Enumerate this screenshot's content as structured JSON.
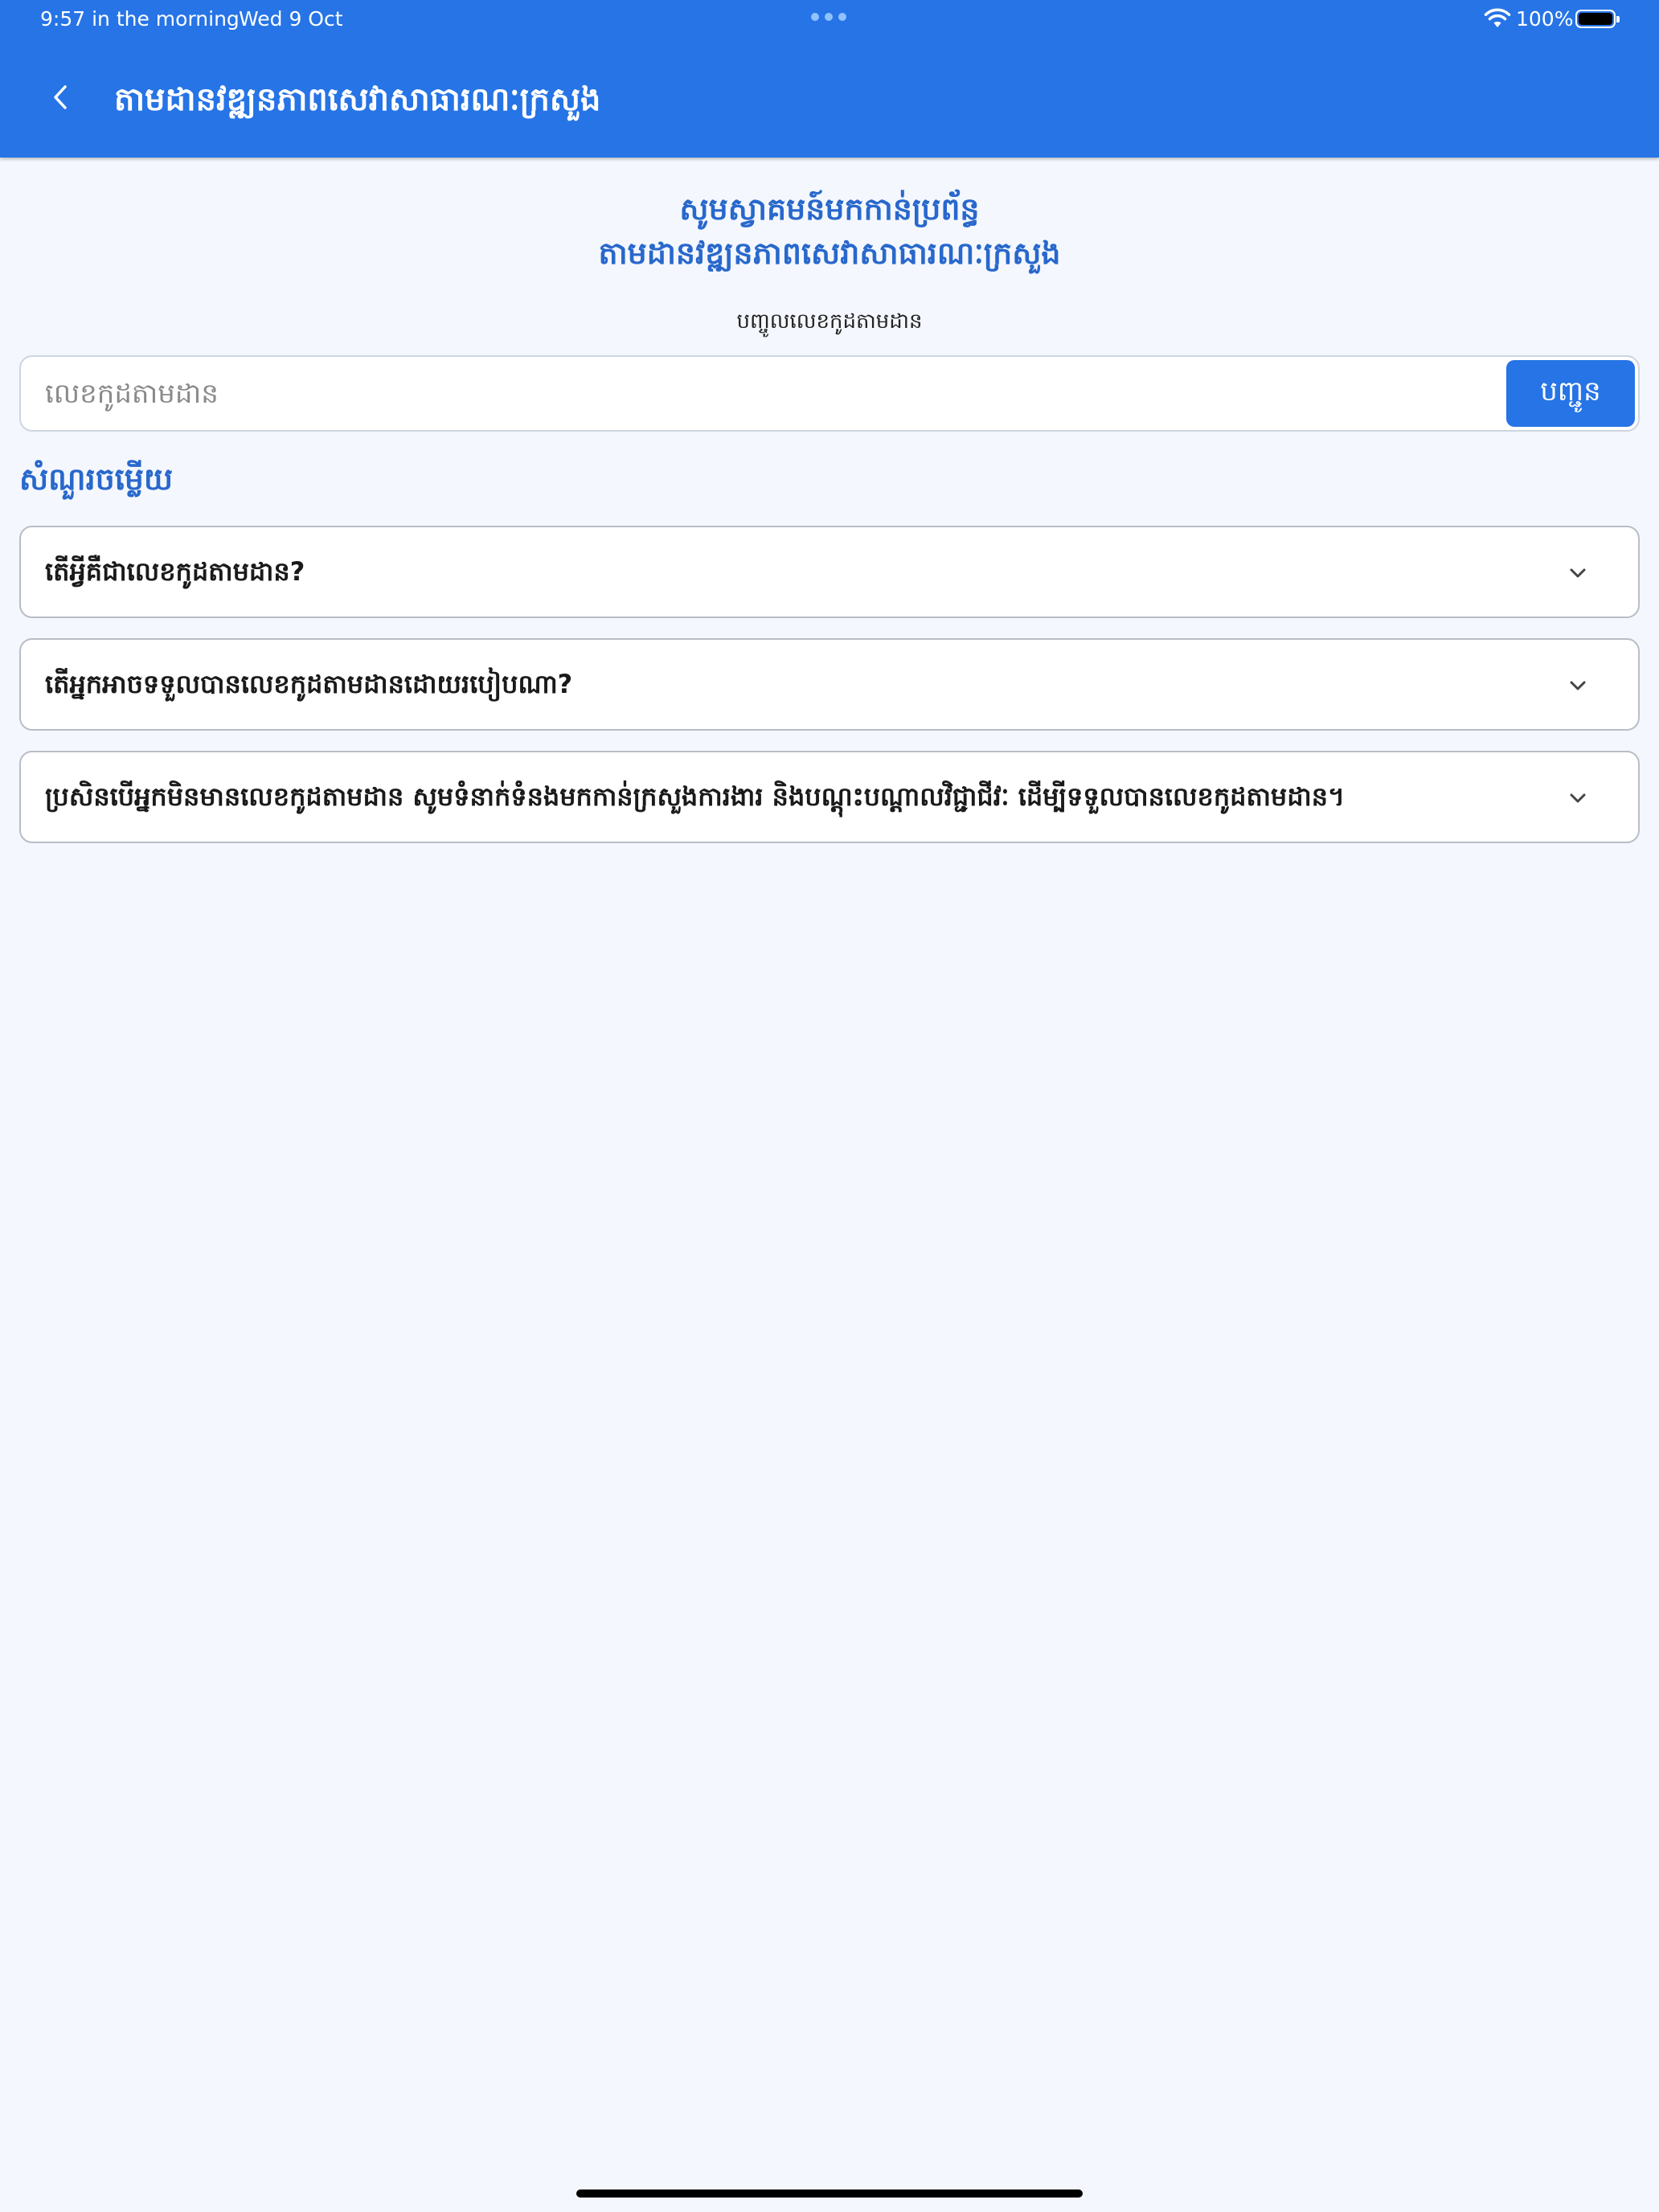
{
  "status_bar": {
    "time": "9:57 in the morning",
    "date": "Wed 9 Oct",
    "battery_percent": "100%",
    "wifi_icon": "wifi-icon",
    "battery_icon": "battery-icon"
  },
  "nav": {
    "back_icon": "chevron-left-icon",
    "title": "តាមដានវឌ្ឍនភាពសេវាសាធារណៈក្រសួង"
  },
  "welcome": {
    "line1": "សូមស្វាគមន៍មកកាន់ប្រព័ន្ធ",
    "line2": "តាមដានវឌ្ឍនភាពសេវាសាធារណៈក្រសួង"
  },
  "search": {
    "label": "បញ្ចូលលេខកូដតាមដាន",
    "placeholder": "លេខកូដតាមដាន",
    "value": "",
    "submit_label": "បញ្ជូន"
  },
  "faq": {
    "heading": "សំណួរចម្លើយ",
    "items": [
      {
        "question": "តើអ្វីគឺជាលេខកូដតាមដាន?",
        "expanded": false
      },
      {
        "question": "តើអ្នកអាចទទួលបានលេខកូដតាមដានដោយរបៀបណា?",
        "expanded": false
      },
      {
        "question": "ប្រសិនបើអ្នកមិនមានលេខកូដតាមដាន សូមទំនាក់ទំនងមកកាន់ក្រសួងការងារ និងបណ្តុះបណ្តាលវិជ្ជាជីវៈ ដើម្បីទទួលបានលេខកូដតាមដាន។",
        "expanded": false
      }
    ]
  },
  "colors": {
    "accent": "#2674e6",
    "heading": "#2868cc",
    "background": "#f4f7fd"
  }
}
